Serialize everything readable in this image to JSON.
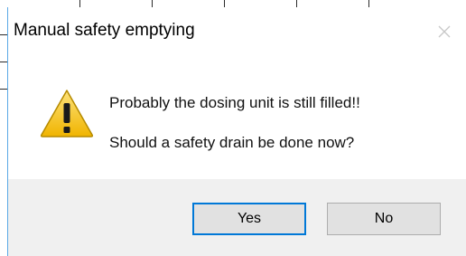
{
  "window": {
    "title": "Manual safety emptying",
    "close_icon": "close-icon"
  },
  "message": {
    "icon": "warning-icon",
    "line1": "Probably the dosing unit is still filled!!",
    "line2": "Should a safety drain be done now?"
  },
  "buttons": {
    "yes_label": "Yes",
    "no_label": "No",
    "default": "yes"
  },
  "colors": {
    "accent": "#0078d7",
    "warning_fill": "#f5c518",
    "footer_bg": "#f0f0f0"
  }
}
